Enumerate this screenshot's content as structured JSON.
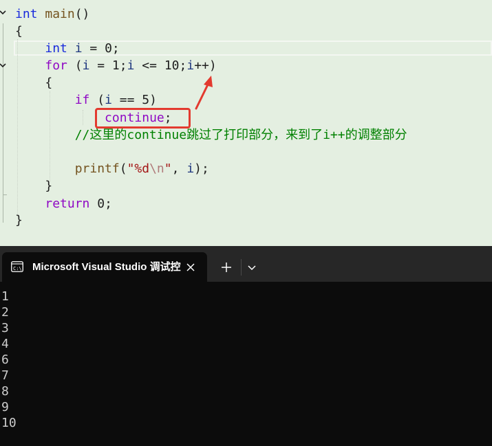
{
  "editor": {
    "tokens": {
      "int": "int",
      "main": "main",
      "parens": "()",
      "brace_open": "{",
      "brace_close": "}",
      "space": " ",
      "indent1": "    ",
      "indent2": "        ",
      "indent3": "            ",
      "i": "i",
      "assign": " = ",
      "zero": "0",
      "semicolon": ";",
      "for": "for",
      "for_open": " (",
      "one": "1",
      "le": " <= ",
      "ten": "10",
      "inc": "++",
      "close_paren": ")",
      "if": "if",
      "eqeq": " == ",
      "five": "5",
      "continue": "continue",
      "comment": "//这里的continue跳过了打印部分，来到了i++的调整部分",
      "printf": "printf",
      "lparen": "(",
      "str_open": "\"%d",
      "esc_n": "\\n",
      "str_close": "\"",
      "comma": ", ",
      "return": "return"
    },
    "annotation": {
      "box_color": "#e33a2f",
      "arrow_color": "#e33a2f"
    }
  },
  "terminal": {
    "tab_title": "Microsoft Visual Studio 调试控",
    "icons": {
      "tab": "console-icon",
      "close": "close-icon",
      "new": "plus-icon",
      "menu": "chevron-down-icon"
    },
    "output": [
      "1",
      "2",
      "3",
      "4",
      "6",
      "7",
      "8",
      "9",
      "10"
    ]
  }
}
